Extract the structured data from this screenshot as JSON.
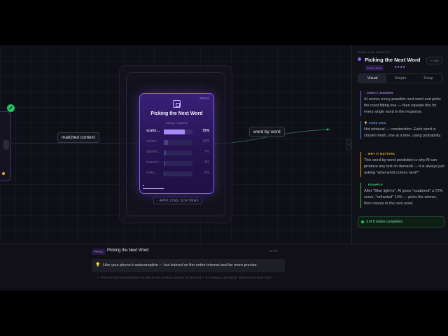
{
  "canvas": {
    "left_node": {
      "status": "complete"
    },
    "edge_labels": {
      "input": "matched context",
      "output": "word by word"
    },
    "card": {
      "tag": "PROC",
      "title": "Picking the Next Word",
      "meta_left": "softmax",
      "meta_right": "5 choices",
      "rows": [
        {
          "word": "scatte…",
          "percent": "72%",
          "fraction": 0.72,
          "highlight": true
        },
        {
          "word": "refract…",
          "percent": "14%",
          "fraction": 0.14,
          "highlight": false
        },
        {
          "word": "absorb…",
          "percent": "7%",
          "fraction": 0.07,
          "highlight": false
        },
        {
          "word": "bounce…",
          "percent": "4%",
          "fraction": 0.04,
          "highlight": false
        },
        {
          "word": "reflec…",
          "percent": "3%",
          "fraction": 0.03,
          "highlight": false
        }
      ]
    },
    "softmax_label": "APPLYING SOFTMAX"
  },
  "panel": {
    "kicker": "WHAT IS AI, REALLY?",
    "title": "Picking the Next Word",
    "link_btn": "LINK",
    "badge": "PROCESS",
    "stars": "★★★★",
    "tabs": [
      "Visual",
      "Simple",
      "Deep"
    ],
    "active_tab": "Visual",
    "sections": [
      {
        "heading": "DIRECT ANSWER",
        "body": "AI scores every possible next word and picks the most fitting one — then repeats this for every single word in the response."
      },
      {
        "heading": "CORE IDEA",
        "body": "Not retrieval — construction. Each word is chosen fresh, one at a time, using probability."
      },
      {
        "heading": "WHY IT MATTERS",
        "body": "This word-by-word prediction is why AI can produce any text on demand — it is always just asking \"what word comes next?\""
      },
      {
        "heading": "EXAMPLE",
        "body": "After \"Blue light is\", AI gives \"scattered\" a 72% score, \"refracted\" 14% — picks the winner, then moves to the next word."
      }
    ],
    "completed": "3 of 5 nodes completed"
  },
  "bottom": {
    "tag": "PROC",
    "title": "Picking the Next Word",
    "pager": "‹  3 / 5  ›",
    "analogy": "Like your phone's autocomplete — but trained on the entire internet and far more precise.",
    "footnote": "This word-by-word prediction is why AI can produce any text on demand — it is always just asking \"what word comes next?\""
  },
  "colors": {
    "accent": "#8b5cf6",
    "success": "#22c55e",
    "amber": "#f59e0b",
    "blue": "#3b82f6"
  }
}
